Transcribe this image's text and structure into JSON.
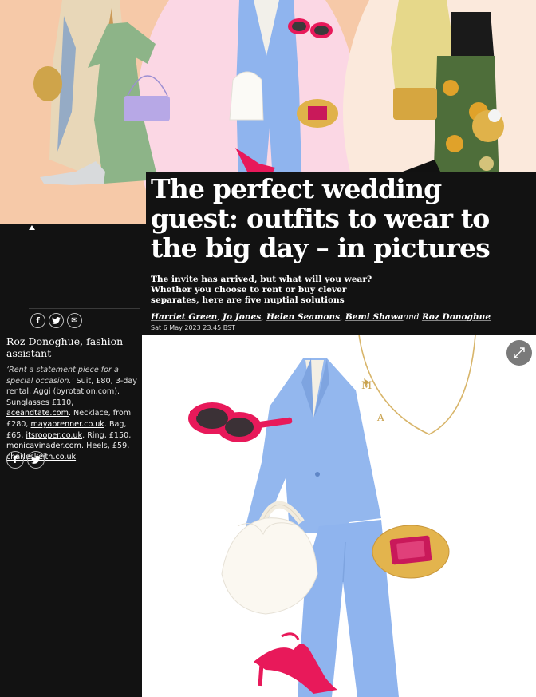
{
  "article": {
    "headline": "The perfect wedding guest: outfits to wear to the big day – in pictures",
    "standfirst": "The invite has arrived, but what will you wear? Whether you choose to rent or buy clever separates, here are five nuptial solutions",
    "byline": {
      "authors": [
        "Harriet Green",
        "Jo Jones",
        "Helen Seamons",
        "Bemi Shawa",
        "Roz Donoghue"
      ],
      "separator": ", ",
      "conjunction": "and "
    },
    "date": "Sat 6 May 2023 23.45 BST"
  },
  "credit": {
    "name": "Roz Donoghue, fashion assistant"
  },
  "caption": {
    "quote": "‘Rent a statement piece for a special occasion.’",
    "t1": " Suit, £80, 3-day rental, Aggi (byrotation.com). Sunglasses £110, ",
    "l1": "aceandtate.com",
    "t2": ". Necklace, from £280, ",
    "l2": "mayabrenner.co.uk",
    "t3": ". Bag, £65, ",
    "l3": "itsrooper.co.uk",
    "t4": ". Ring, £150, ",
    "l4": "monicavinader.com",
    "t5": ". Heels, £59, ",
    "l5": "charleskeith.co.uk"
  },
  "share": {
    "facebook_glyph": "f",
    "twitter_glyph": "🐦",
    "email_glyph": "✉"
  },
  "icons": {
    "up_caret": "caret-up-icon",
    "facebook": "facebook-icon",
    "twitter": "twitter-icon",
    "email": "email-icon",
    "expand": "expand-icon"
  },
  "colors": {
    "background": "#121212",
    "hero_peach": "#f6c9a8",
    "hero_pink": "#fbd7e4",
    "suit_blue": "#8fb4ee",
    "accent_pink": "#e8195a"
  }
}
